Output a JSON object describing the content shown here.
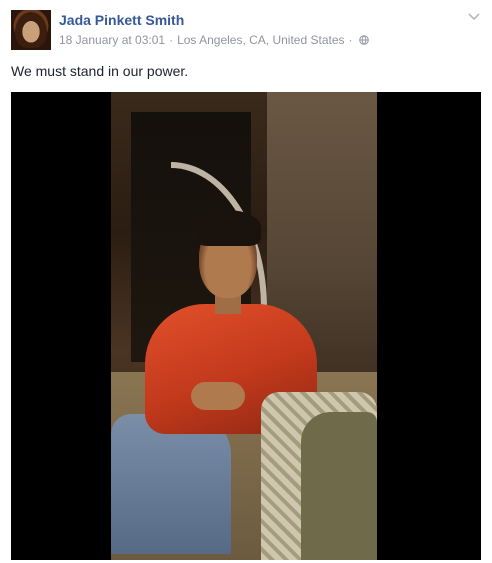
{
  "post": {
    "author": "Jada Pinkett Smith",
    "date": "18 January at 03:01",
    "separator": "·",
    "location": "Los Angeles, CA, United States",
    "separator2": "·",
    "privacy_icon": "globe-icon",
    "menu_icon": "chevron-down-icon",
    "text": "We must stand in our power."
  },
  "colors": {
    "author_link": "#365899",
    "meta_text": "#90949c",
    "body_text": "#1d2129",
    "video_background": "#000000"
  }
}
